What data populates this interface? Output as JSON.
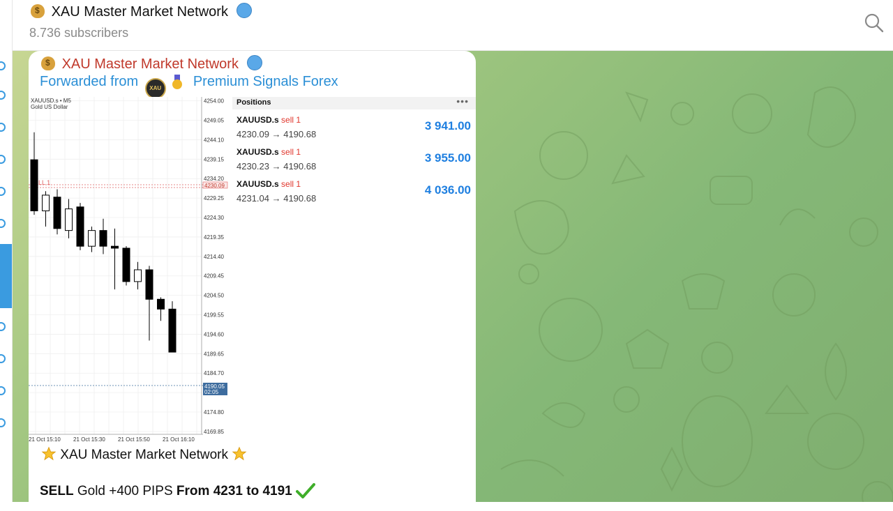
{
  "header": {
    "channel_name": "XAU Master Market Network",
    "subscribers": "8.736 subscribers",
    "icons": [
      "money-bag-icon",
      "globe-icon",
      "search-icon"
    ]
  },
  "message": {
    "channel_name": "XAU Master Market Network",
    "forwarded_prefix": "Forwarded from",
    "forwarded_source": "Premium Signals Forex",
    "line1_text": "XAU Master Market Network",
    "line2_sell": "SELL",
    "line2_gold": "Gold +400 PIPS",
    "line2_from": "From 4231 to 4191",
    "colors": {
      "channel": "#c0392b",
      "forward": "#2b8fd6",
      "profit": "#1e7fe0",
      "sell": "#e0362c"
    }
  },
  "chart": {
    "symbol": "XAUUSD.s • M5",
    "instrument": "Gold US Dollar",
    "sell_tag": "SELL 1",
    "current_price": "4190.05",
    "countdown": "02:05",
    "entry_level": "4230.09",
    "more": "•••",
    "price_ticks": [
      "4254.00",
      "4249.05",
      "4244.10",
      "4239.15",
      "4234.20",
      "4229.25",
      "4224.30",
      "4219.35",
      "4214.40",
      "4209.45",
      "4204.50",
      "4199.55",
      "4194.60",
      "4189.65",
      "4184.70",
      "4179.75",
      "4174.80",
      "4169.85"
    ],
    "time_ticks": [
      "21 Oct 15:10",
      "21 Oct 15:30",
      "21 Oct 15:50",
      "21 Oct 16:10"
    ]
  },
  "chart_data": {
    "type": "candlestick",
    "title": "XAUUSD.s • M5",
    "subtitle": "Gold US Dollar",
    "ylim": [
      4167,
      4255
    ],
    "candles": [
      {
        "o": 4239.0,
        "h": 4246.0,
        "l": 4225.0,
        "c": 4226.0
      },
      {
        "o": 4226.0,
        "h": 4231.0,
        "l": 4222.0,
        "c": 4230.0
      },
      {
        "o": 4229.5,
        "h": 4231.5,
        "l": 4220.0,
        "c": 4221.5
      },
      {
        "o": 4221.0,
        "h": 4229.0,
        "l": 4219.0,
        "c": 4226.5
      },
      {
        "o": 4227.0,
        "h": 4228.0,
        "l": 4216.0,
        "c": 4217.0
      },
      {
        "o": 4217.0,
        "h": 4222.0,
        "l": 4215.5,
        "c": 4221.0
      },
      {
        "o": 4221.0,
        "h": 4224.0,
        "l": 4215.0,
        "c": 4217.0
      },
      {
        "o": 4217.0,
        "h": 4221.5,
        "l": 4206.0,
        "c": 4216.5
      },
      {
        "o": 4216.5,
        "h": 4217.0,
        "l": 4207.0,
        "c": 4208.0
      },
      {
        "o": 4208.0,
        "h": 4213.0,
        "l": 4206.0,
        "c": 4211.0
      },
      {
        "o": 4211.0,
        "h": 4212.0,
        "l": 4193.0,
        "c": 4203.5
      },
      {
        "o": 4203.5,
        "h": 4204.0,
        "l": 4198.0,
        "c": 4201.0
      },
      {
        "o": 4201.0,
        "h": 4203.0,
        "l": 4190.0,
        "c": 4190.05
      }
    ]
  },
  "positions": {
    "header": "Positions",
    "more": "•••",
    "rows": [
      {
        "symbol": "XAUUSD.s",
        "side": "sell 1",
        "prices": "4230.09 → 4190.68",
        "profit": "3 941.00"
      },
      {
        "symbol": "XAUUSD.s",
        "side": "sell 1",
        "prices": "4230.23 → 4190.68",
        "profit": "3 955.00"
      },
      {
        "symbol": "XAUUSD.s",
        "side": "sell 1",
        "prices": "4231.04 → 4190.68",
        "profit": "4 036.00"
      }
    ]
  }
}
